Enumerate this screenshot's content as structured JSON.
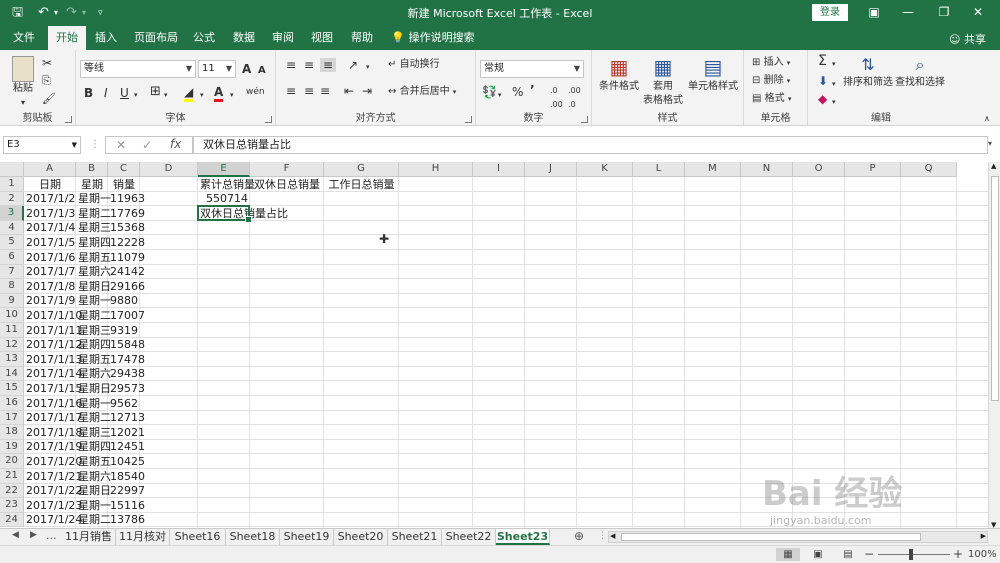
{
  "window": {
    "title": "新建 Microsoft Excel 工作表 - Excel",
    "login_label": "登录",
    "share_label": "共享"
  },
  "tabs": [
    {
      "label": "文件"
    },
    {
      "label": "开始"
    },
    {
      "label": "插入"
    },
    {
      "label": "页面布局"
    },
    {
      "label": "公式"
    },
    {
      "label": "数据"
    },
    {
      "label": "审阅"
    },
    {
      "label": "视图"
    },
    {
      "label": "帮助"
    }
  ],
  "tell_me": "操作说明搜索",
  "ribbon": {
    "clipboard": {
      "paste": "粘贴",
      "label": "剪贴板"
    },
    "font": {
      "name": "等线",
      "size": "11",
      "label": "字体",
      "bold": "B",
      "italic": "I",
      "underline": "U",
      "grow": "A",
      "shrink": "A",
      "phonetic": "wén"
    },
    "alignment": {
      "wrap": "自动换行",
      "merge": "合并后居中",
      "label": "对齐方式"
    },
    "number": {
      "format": "常规",
      "percent": "%",
      "comma": "9",
      "label": "数字"
    },
    "styles": {
      "conditional": "条件格式",
      "table_line1": "套用",
      "table_line2": "表格格式",
      "cell_styles": "单元格样式",
      "label": "样式"
    },
    "cells": {
      "insert": "插入",
      "delete": "删除",
      "format": "格式",
      "label": "单元格"
    },
    "editing": {
      "sort": "排序和筛选",
      "find": "查找和选择",
      "label": "编辑"
    }
  },
  "formula_bar": {
    "name_box": "E3",
    "content": "双休日总销量占比"
  },
  "columns": [
    "A",
    "B",
    "C",
    "D",
    "E",
    "F",
    "G",
    "H",
    "I",
    "J",
    "K",
    "L",
    "M",
    "N",
    "O",
    "P",
    "Q"
  ],
  "rows": [
    "1",
    "2",
    "3",
    "4",
    "5",
    "6",
    "7",
    "8",
    "9",
    "10",
    "11",
    "12",
    "13",
    "14",
    "15",
    "16",
    "17",
    "18",
    "19",
    "20",
    "21",
    "22",
    "23",
    "24"
  ],
  "headers": {
    "date": "日期",
    "weekday": "星期",
    "sales": "销量"
  },
  "data": [
    [
      "2017/1/2",
      "星期一",
      "11963"
    ],
    [
      "2017/1/3",
      "星期二",
      "17769"
    ],
    [
      "2017/1/4",
      "星期三",
      "15368"
    ],
    [
      "2017/1/5",
      "星期四",
      "12228"
    ],
    [
      "2017/1/6",
      "星期五",
      "11079"
    ],
    [
      "2017/1/7",
      "星期六",
      "24142"
    ],
    [
      "2017/1/8",
      "星期日",
      "29166"
    ],
    [
      "2017/1/9",
      "星期一",
      "9880"
    ],
    [
      "2017/1/10",
      "星期二",
      "17007"
    ],
    [
      "2017/1/11",
      "星期三",
      "9319"
    ],
    [
      "2017/1/12",
      "星期四",
      "15848"
    ],
    [
      "2017/1/13",
      "星期五",
      "17478"
    ],
    [
      "2017/1/14",
      "星期六",
      "29438"
    ],
    [
      "2017/1/15",
      "星期日",
      "29573"
    ],
    [
      "2017/1/16",
      "星期一",
      "9562"
    ],
    [
      "2017/1/17",
      "星期二",
      "12713"
    ],
    [
      "2017/1/18",
      "星期三",
      "12021"
    ],
    [
      "2017/1/19",
      "星期四",
      "12451"
    ],
    [
      "2017/1/20",
      "星期五",
      "10425"
    ],
    [
      "2017/1/21",
      "星期六",
      "18540"
    ],
    [
      "2017/1/22",
      "星期日",
      "22997"
    ],
    [
      "2017/1/23",
      "星期一",
      "15116"
    ],
    [
      "2017/1/24",
      "星期二",
      "13786"
    ]
  ],
  "summary": {
    "e1": "累计总销量",
    "f1": "双休日总销量",
    "g1": "工作日总销量",
    "e2": "550714",
    "e3": "双休日总销量占比"
  },
  "sheets": [
    "11月销售",
    "11月核对",
    "Sheet16",
    "Sheet18",
    "Sheet19",
    "Sheet20",
    "Sheet21",
    "Sheet22",
    "Sheet23"
  ],
  "sheet_more": "...",
  "status": {
    "zoom": "100%"
  },
  "watermark": {
    "brand": "Bai 经验",
    "url": "jingyan.baidu.com"
  },
  "colors": {
    "accent": "#217346"
  }
}
